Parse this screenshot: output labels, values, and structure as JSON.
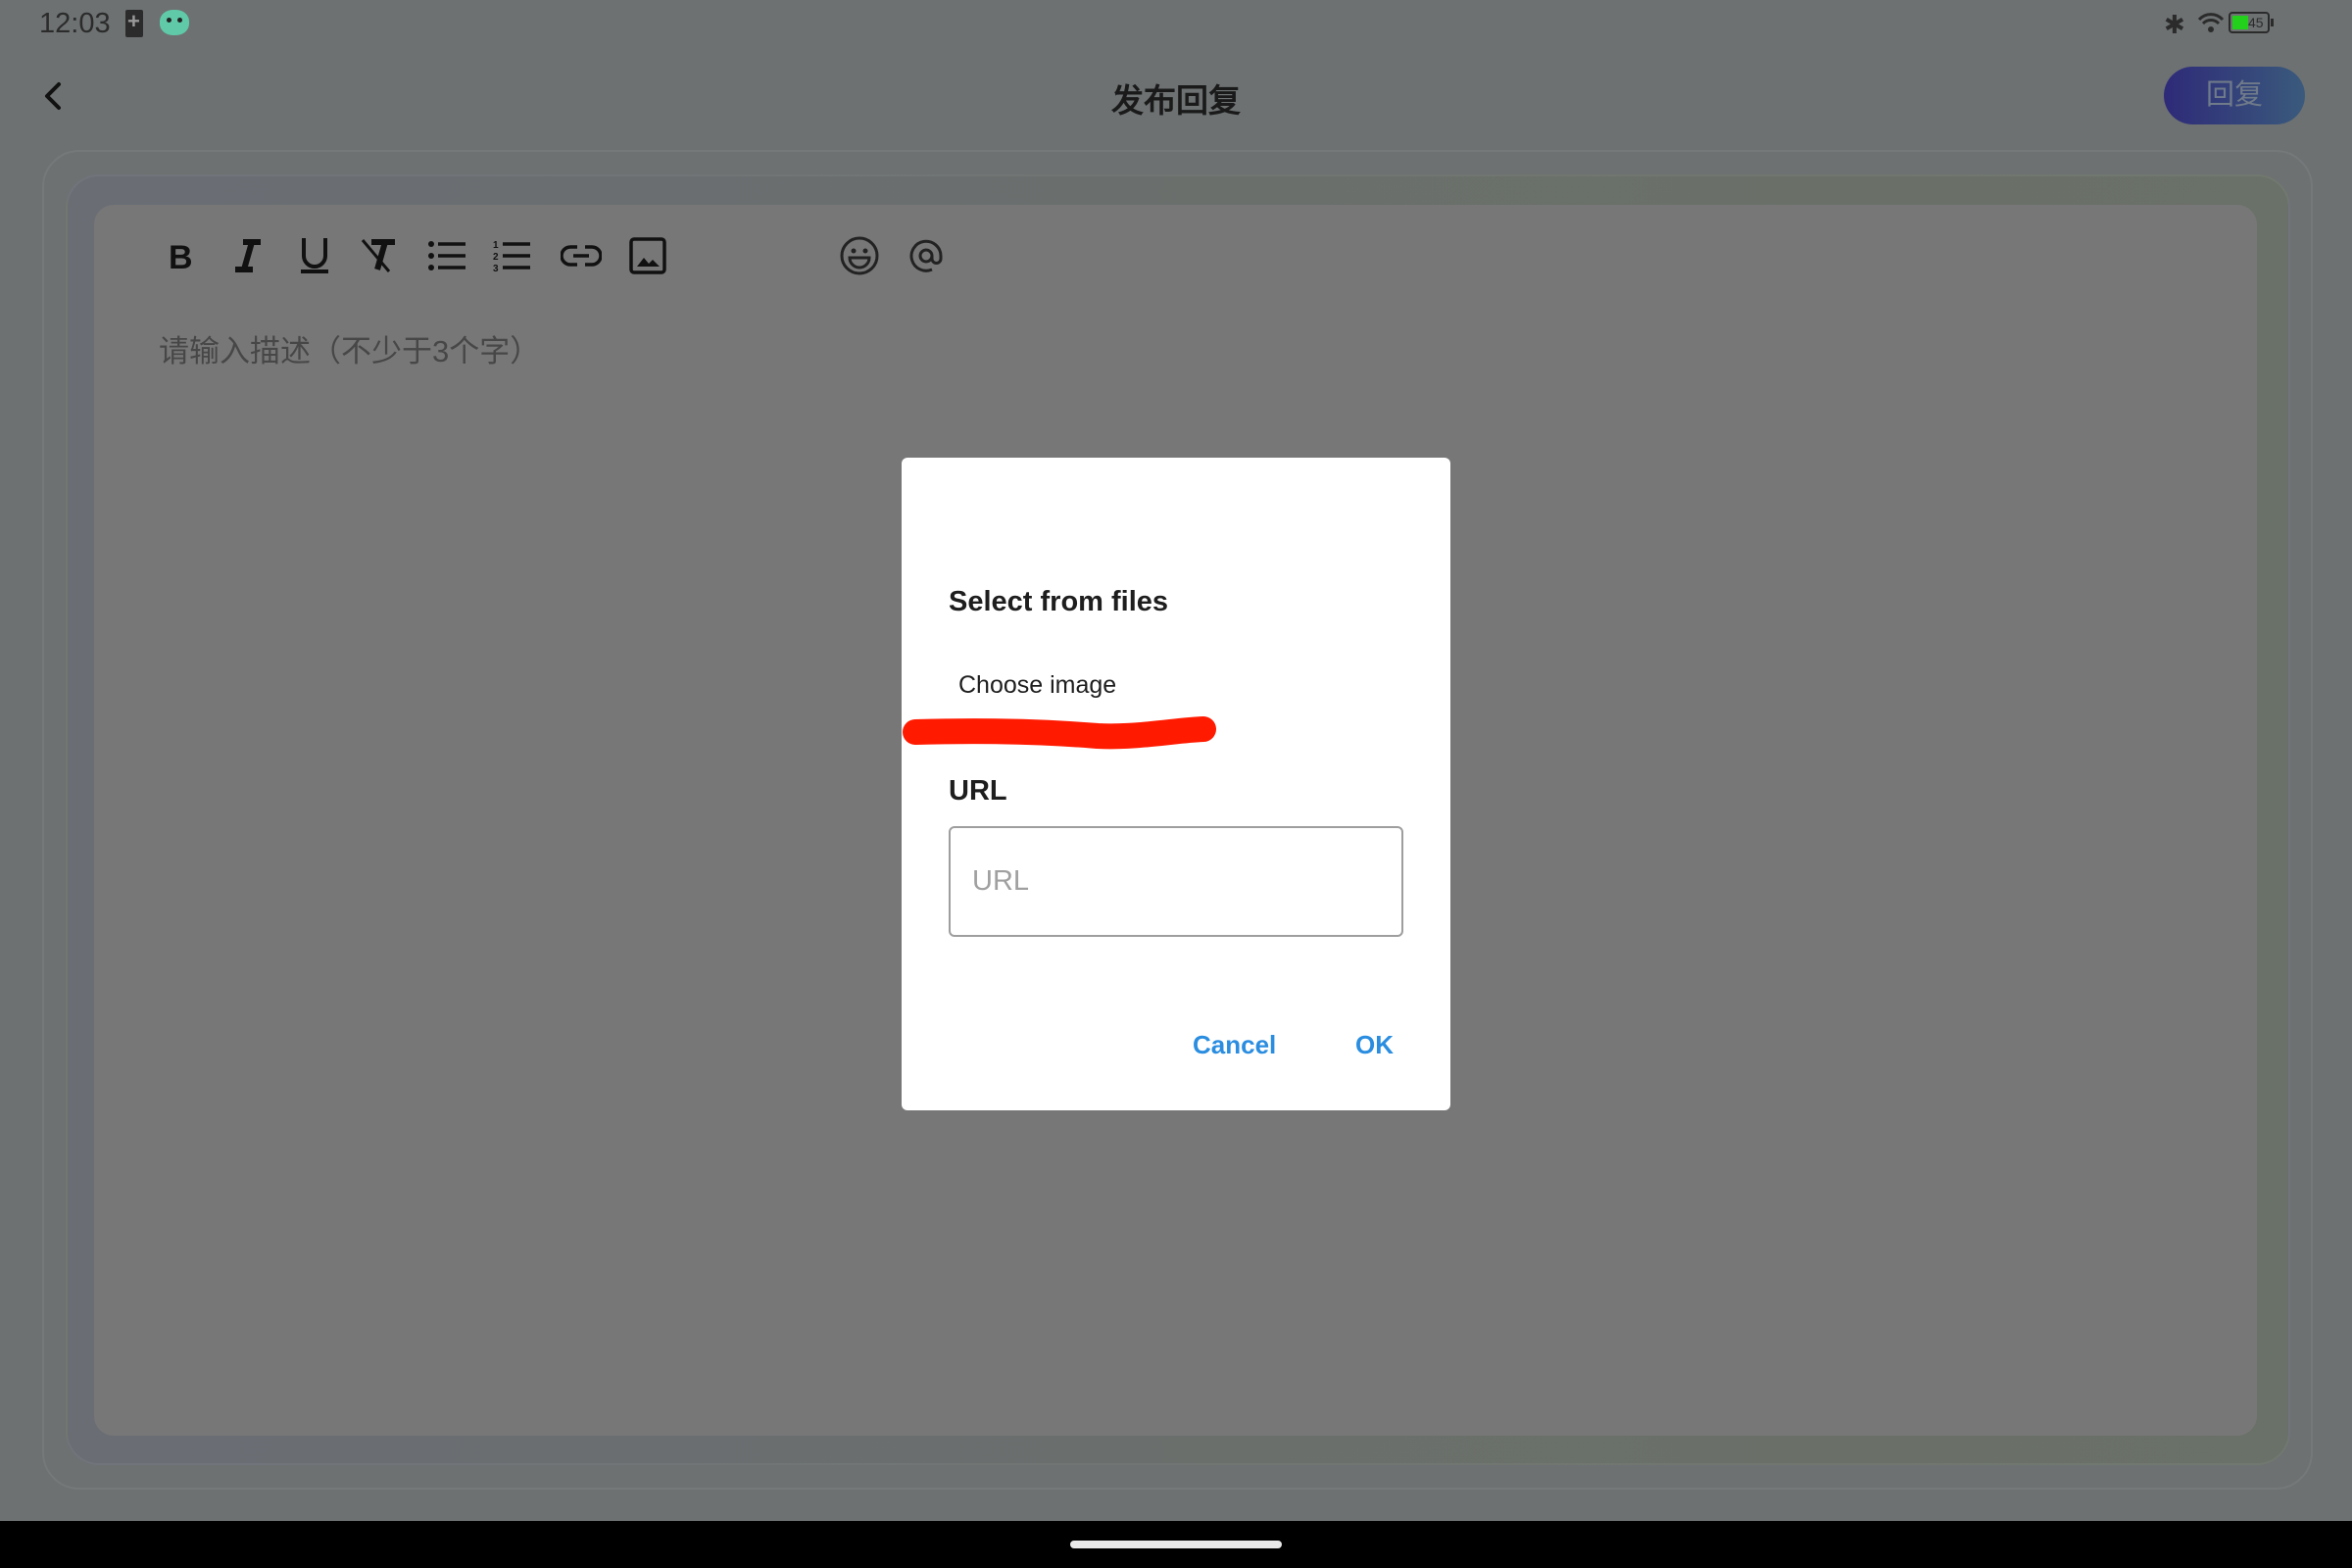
{
  "status_bar": {
    "time": "12:03",
    "battery_level": "45",
    "icons": [
      "battery-charging-icon",
      "app-mascot-icon",
      "bluetooth-icon",
      "wifi-icon",
      "battery-icon"
    ]
  },
  "header": {
    "title": "发布回复",
    "back_icon": "chevron-left-icon",
    "reply_button": "回复"
  },
  "editor": {
    "toolbar": [
      {
        "name": "bold",
        "icon": "bold-icon"
      },
      {
        "name": "italic",
        "icon": "italic-icon"
      },
      {
        "name": "underline",
        "icon": "underline-icon"
      },
      {
        "name": "clear-format",
        "icon": "clear-format-icon"
      },
      {
        "name": "bullet-list",
        "icon": "bullet-list-icon"
      },
      {
        "name": "numbered-list",
        "icon": "numbered-list-icon"
      },
      {
        "name": "link",
        "icon": "link-icon"
      },
      {
        "name": "image",
        "icon": "image-icon"
      },
      {
        "name": "emoji",
        "icon": "emoji-icon"
      },
      {
        "name": "mention",
        "icon": "at-icon"
      }
    ],
    "placeholder": "请输入描述（不少于3个字）"
  },
  "dialog": {
    "title": "Select from files",
    "choose_image": "Choose image",
    "url_label": "URL",
    "url_value": "",
    "url_placeholder": "URL",
    "cancel": "Cancel",
    "ok": "OK",
    "accent_color": "#2a8de0",
    "annotation_color": "#ff1a00"
  }
}
